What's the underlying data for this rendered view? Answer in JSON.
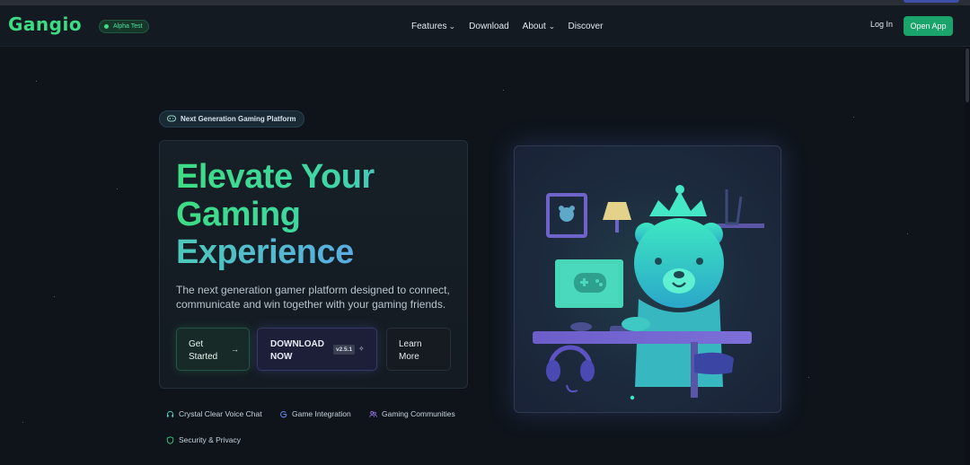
{
  "nav": {
    "logo": "Gangio",
    "badge": "Alpha Test",
    "links": [
      {
        "label": "Features",
        "has_dropdown": true
      },
      {
        "label": "Download",
        "has_dropdown": false
      },
      {
        "label": "About",
        "has_dropdown": true
      },
      {
        "label": "Discover",
        "has_dropdown": false
      }
    ],
    "login": "Log In",
    "open_app": "Open App"
  },
  "hero": {
    "pill": "Next Generation Gaming Platform",
    "headline": [
      "Elevate Your",
      "Gaming",
      "Experience"
    ],
    "description": "The next generation gamer platform designed to connect, communicate and win together with your gaming friends.",
    "buttons": {
      "get_started": [
        "Get",
        "Started"
      ],
      "download": [
        "DOWNLOAD",
        "NOW"
      ],
      "version": "v2.5.1",
      "learn_more": [
        "Learn",
        "More"
      ]
    },
    "features": [
      {
        "label": "Crystal Clear Voice Chat",
        "icon": "headphones-icon"
      },
      {
        "label": "Game Integration",
        "icon": "game-integration-icon"
      },
      {
        "label": "Gaming Communities",
        "icon": "users-icon"
      },
      {
        "label": "Security & Privacy",
        "icon": "shield-icon"
      }
    ]
  },
  "colors": {
    "brand_green": "#3ddc84",
    "background": "#0f141b",
    "open_app_bg": "#1aa36a",
    "download_bg": "#1c1f37"
  }
}
